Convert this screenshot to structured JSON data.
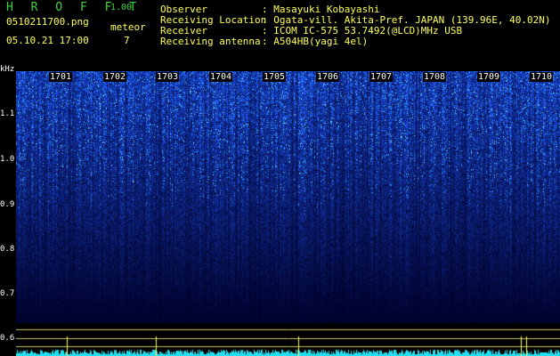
{
  "header": {
    "app_name": "H R O F F T",
    "version": "1.00",
    "filename": "0510211700.png",
    "meteor_label": "meteor",
    "datetime": "05.10.21 17:00",
    "meteor_count": "7"
  },
  "info": [
    {
      "label": "Observer",
      "value": ": Masayuki Kobayashi"
    },
    {
      "label": "Receiving Location",
      "value": ": Ogata-vill. Akita-Pref. JAPAN (139.96E, 40.02N)"
    },
    {
      "label": "Receiver",
      "value": ": ICOM IC-575 53.7492(@LCD)MHz USB"
    },
    {
      "label": "Receiving antenna",
      "value": ": A504HB(yagi 4el)"
    }
  ],
  "y_axis": {
    "unit": "kHz",
    "ticks": [
      "1.1",
      "1.0",
      "0.9",
      "0.8",
      "0.7",
      "0.6"
    ]
  },
  "x_axis": {
    "ticks": [
      "1701",
      "1702",
      "1703",
      "1704",
      "1705",
      "1706",
      "1707",
      "1708",
      "1709",
      "1710"
    ]
  },
  "colors": {
    "background": "#000000",
    "header_green": "#3dd43d",
    "spectrogram_deep": "#000c46",
    "spectrogram_bright": "#2a6cff",
    "noise_trace": "#22e0f0",
    "reference_lines": "#c9c26a"
  }
}
